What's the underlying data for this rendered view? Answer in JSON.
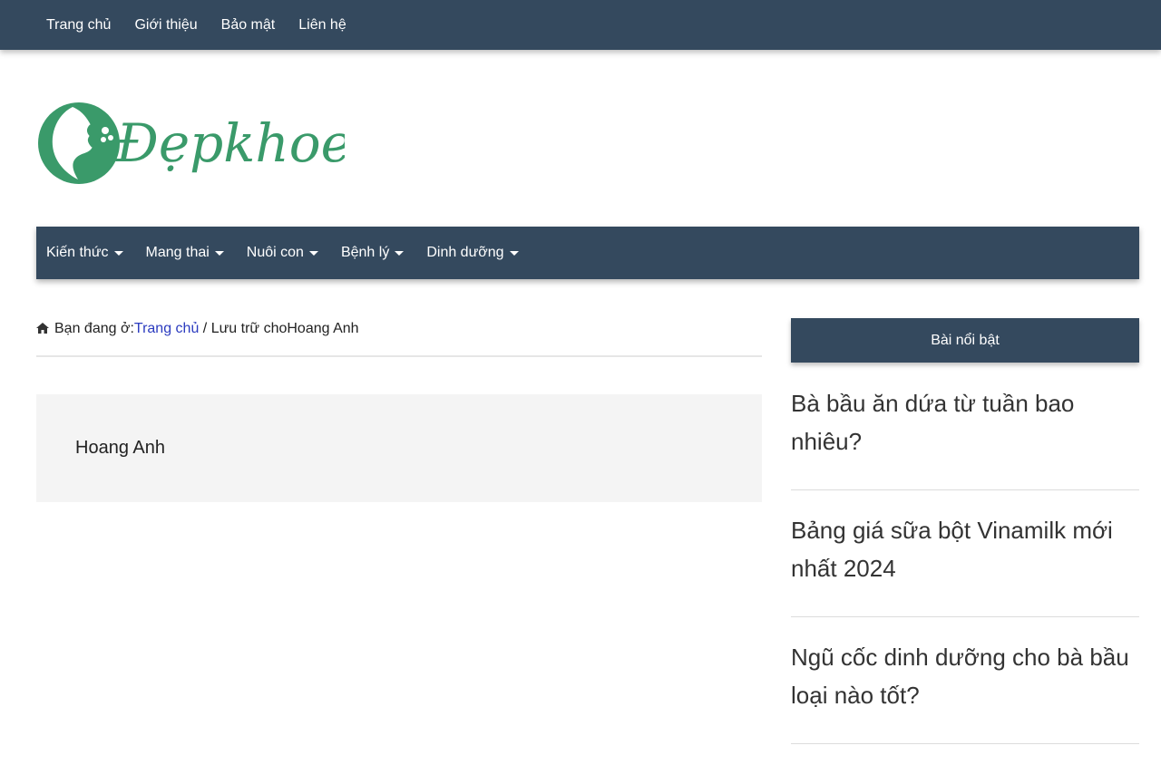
{
  "topnav": {
    "items": [
      "Trang chủ",
      "Giới thiệu",
      "Bảo mật",
      "Liên hệ"
    ]
  },
  "logo": {
    "text": "Đẹpkhoe",
    "color": "#3a9a6a"
  },
  "mainnav": {
    "items": [
      "Kiến thức",
      "Mang thai",
      "Nuôi con",
      "Bệnh lý",
      "Dinh dưỡng"
    ]
  },
  "breadcrumb": {
    "prefix": "Bạn đang ở:",
    "home": "Trang chủ",
    "separator": " / ",
    "current": "Lưu trữ choHoang Anh"
  },
  "archive": {
    "title": "Hoang Anh"
  },
  "sidebar": {
    "widget_title": "Bài nổi bật",
    "posts": [
      "Bà bầu ăn dứa từ tuần bao nhiêu?",
      "Bảng giá sữa bột Vinamilk mới nhất 2024",
      "Ngũ cốc dinh dưỡng cho bà bầu loại nào tốt?"
    ]
  },
  "colors": {
    "nav_bg": "#34495e",
    "link": "#2b3bbf",
    "archive_bg": "#f4f4f4"
  }
}
